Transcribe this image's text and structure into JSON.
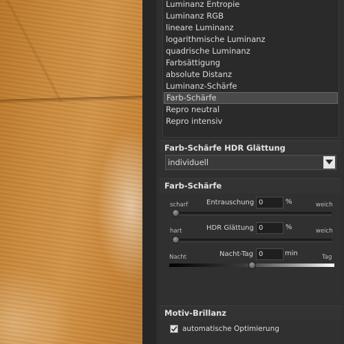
{
  "mode_list": {
    "items": [
      {
        "label": "Luminanz Entropie"
      },
      {
        "label": "Luminanz RGB"
      },
      {
        "label": "lineare Luminanz"
      },
      {
        "label": "logarithmische Luminanz"
      },
      {
        "label": "quadrische Luminanz"
      },
      {
        "label": "Farbsättigung"
      },
      {
        "label": "absolute Distanz"
      },
      {
        "label": "Luminanz-Schärfe"
      },
      {
        "label": "Farb-Schärfe",
        "selected": true
      },
      {
        "label": "Repro neutral"
      },
      {
        "label": "Repro intensiv"
      }
    ]
  },
  "hdr_smoothing": {
    "title": "Farb-Schärfe HDR Glättung",
    "dropdown_value": "individuell"
  },
  "sharpness": {
    "title": "Farb-Schärfe",
    "denoise": {
      "left": "scharf",
      "right": "weich",
      "label": "Entrauschung",
      "value": "0",
      "unit": "%",
      "level": 0
    },
    "hdr": {
      "left": "hart",
      "right": "weich",
      "label": "HDR Glättung",
      "value": "0",
      "unit": "%",
      "level": 0
    },
    "daynight": {
      "left": "Nacht",
      "right": "Tag",
      "label": "Nacht-Tag",
      "value": "0",
      "unit": "min",
      "level": 0.5
    }
  },
  "brilliance": {
    "title": "Motiv-Brillanz",
    "checkbox_label": "automatische Optimierung",
    "checked": true
  },
  "colors": {
    "panel": "#2f2f2f",
    "selected_row": "#4a4a4a",
    "dropdown_arrow_bg": "#e6e6e6"
  },
  "icons": {
    "dropdown": "chevron-down-icon",
    "check": "check-icon"
  }
}
